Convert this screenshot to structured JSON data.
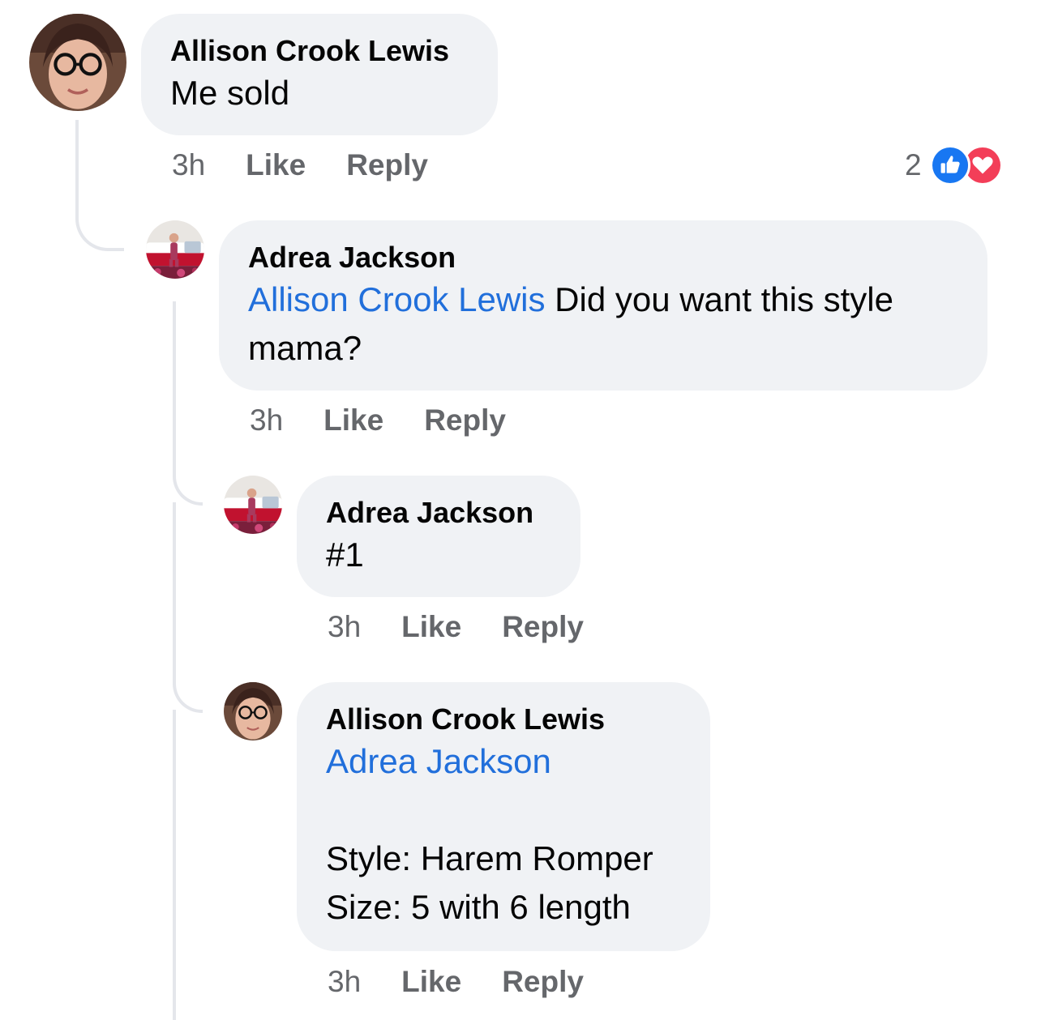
{
  "comments": [
    {
      "author": "Allison Crook Lewis",
      "text": "Me sold",
      "time": "3h",
      "like_label": "Like",
      "reply_label": "Reply",
      "reaction_count": "2",
      "reactions": [
        "like-reaction-icon",
        "love-reaction-icon"
      ],
      "avatar": "woman-with-glasses-avatar"
    },
    {
      "author": "Adrea Jackson",
      "mention": "Allison Crook Lewis",
      "text": " Did you want this style mama?",
      "time": "3h",
      "like_label": "Like",
      "reply_label": "Reply",
      "avatar": "child-by-red-trailer-avatar"
    },
    {
      "author": "Adrea Jackson",
      "text": "#1",
      "time": "3h",
      "like_label": "Like",
      "reply_label": "Reply",
      "avatar": "child-by-red-trailer-avatar"
    },
    {
      "author": "Allison Crook Lewis",
      "mention": "Adrea Jackson",
      "text": "\n\nStyle: Harem Romper\nSize: 5 with 6 length",
      "time": "3h",
      "like_label": "Like",
      "reply_label": "Reply",
      "avatar": "woman-with-glasses-avatar"
    }
  ],
  "colors": {
    "bubble": "#f0f2f5",
    "mention": "#216fdb",
    "meta": "#65676b",
    "like_blue": "#1877f2",
    "love_red": "#f33e58",
    "thread_line": "#e4e6eb"
  }
}
